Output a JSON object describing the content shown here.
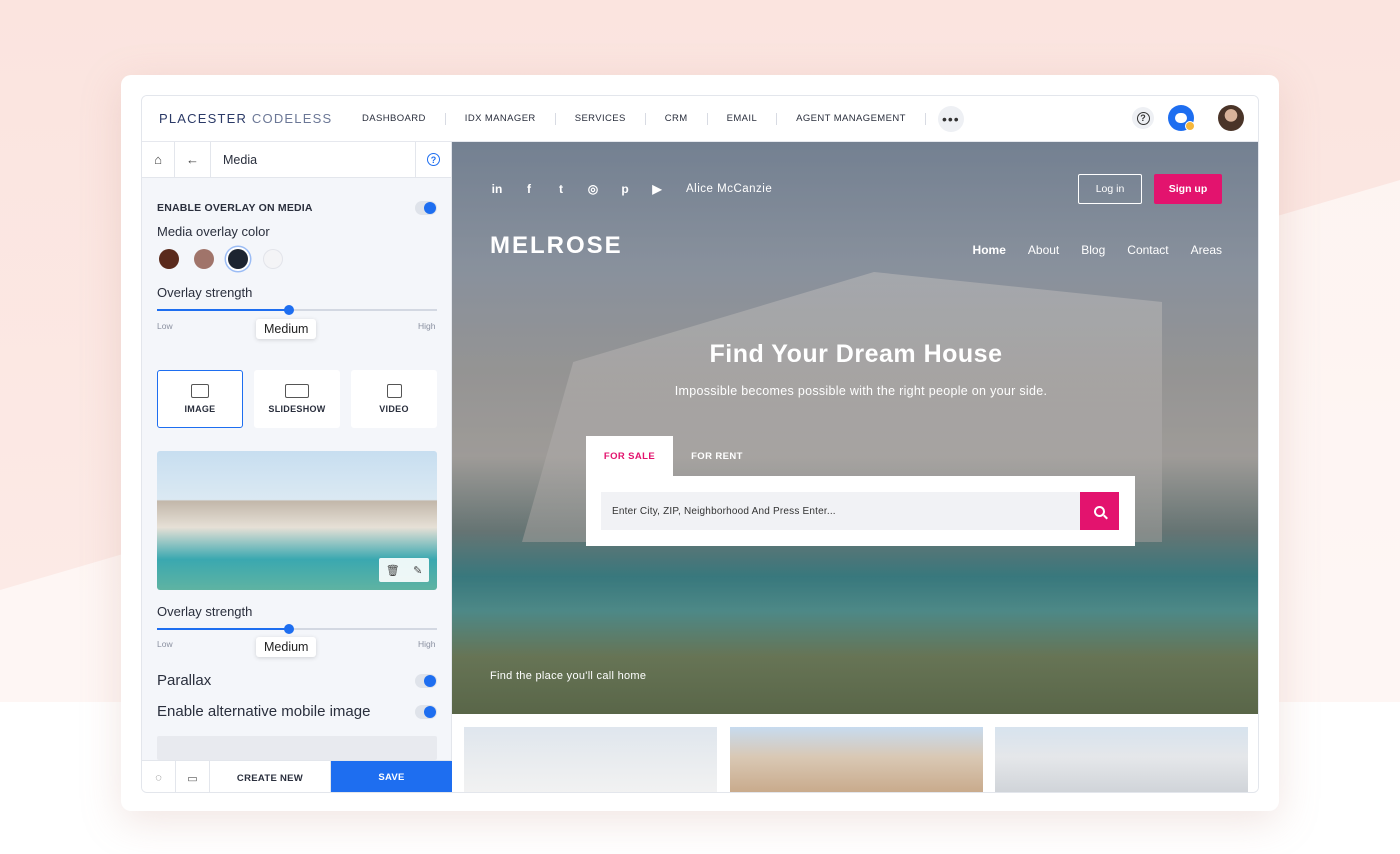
{
  "app": {
    "brand_1": "PLACESTER",
    "brand_2": "CODELESS",
    "nav": [
      "DASHBOARD",
      "IDX MANAGER",
      "SERVICES",
      "CRM",
      "EMAIL",
      "AGENT MANAGEMENT"
    ],
    "more": "•••"
  },
  "panel": {
    "title": "Media",
    "overlay_toggle_label": "ENABLE OVERLAY ON MEDIA",
    "overlay_color_label": "Media overlay color",
    "swatches": [
      "#5a2a1c",
      "#a0746a",
      "#1d2430",
      "#f4f4f6"
    ],
    "overlay_strength_label": "Overlay strength",
    "slider_low": "Low",
    "slider_high": "High",
    "slider_value": "Medium",
    "slider_fraction": 0.47,
    "tabs": [
      "IMAGE",
      "SLIDESHOW",
      "VIDEO"
    ],
    "overlay_strength_label_2": "Overlay strength",
    "slider2_value": "Medium",
    "parallax_label": "Parallax",
    "alt_mobile_label": "Enable alternative mobile image",
    "create_new": "CREATE NEW",
    "save": "SAVE"
  },
  "site": {
    "agent_name": "Alice McCanzie",
    "login": "Log in",
    "signup": "Sign up",
    "logo": "MELROSE",
    "nav": [
      "Home",
      "About",
      "Blog",
      "Contact",
      "Areas"
    ],
    "hero_title": "Find Your Dream House",
    "hero_sub": "Impossible becomes possible with the right people on your side.",
    "tab_sale": "FOR SALE",
    "tab_rent": "FOR RENT",
    "search_placeholder": "Enter City, ZIP, Neighborhood And Press Enter...",
    "hero_footer": "Find the place you'll call home",
    "social": [
      "in",
      "f",
      "t",
      "◎",
      "p",
      "▶"
    ]
  },
  "colors": {
    "accent": "#1e6ef0",
    "brand_pink": "#e3136e"
  }
}
